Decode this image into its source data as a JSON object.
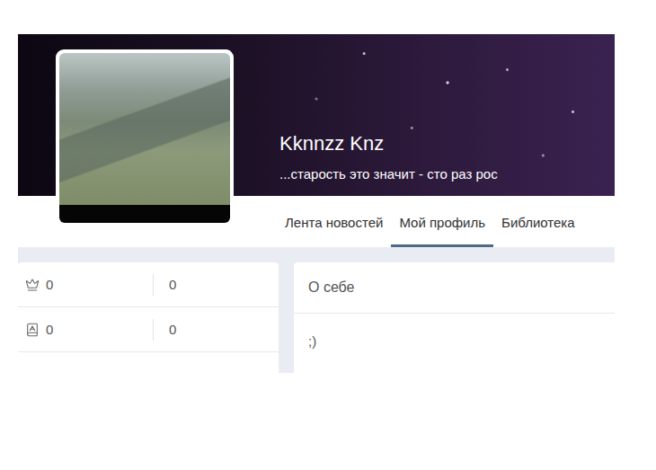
{
  "profile": {
    "name": "Kknnzz Knz",
    "status": "...старость это значит - сто раз рос"
  },
  "tabs": [
    {
      "label": "Лента новостей",
      "selected": false
    },
    {
      "label": "Мой профиль",
      "selected": true
    },
    {
      "label": "Библиотека",
      "selected": false
    }
  ],
  "stats": [
    {
      "kind": "awards",
      "value": "0",
      "extra": "0"
    },
    {
      "kind": "books",
      "value": "0",
      "extra": "0"
    }
  ],
  "about": {
    "title": "О себе",
    "text": ";)"
  }
}
